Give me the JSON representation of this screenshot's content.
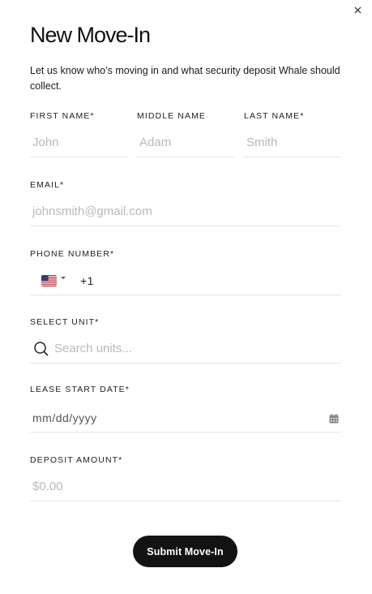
{
  "modal": {
    "title": "New Move-In",
    "subtitle": "Let us know who’s moving in and what security deposit Whale should collect."
  },
  "fields": {
    "first_name": {
      "label": "FIRST NAME*",
      "placeholder": "John"
    },
    "middle_name": {
      "label": "MIDDLE NAME",
      "placeholder": "Adam"
    },
    "last_name": {
      "label": "LAST NAME*",
      "placeholder": "Smith"
    },
    "email": {
      "label": "EMAIL*",
      "placeholder": "johnsmith@gmail.com"
    },
    "phone": {
      "label": "PHONE NUMBER*",
      "country": "US",
      "dial_code": "+1"
    },
    "unit": {
      "label": "SELECT UNIT*",
      "placeholder": "Search units..."
    },
    "lease_start": {
      "label": "LEASE START DATE*",
      "placeholder": "mm/dd/yyyy"
    },
    "deposit": {
      "label": "DEPOSIT AMOUNT*",
      "placeholder": "$0.00"
    }
  },
  "actions": {
    "submit_label": "Submit Move-In"
  },
  "icons": {
    "close": "close-icon",
    "flag": "us-flag-icon",
    "search": "search-icon",
    "calendar": "calendar-icon"
  },
  "colors": {
    "button_bg": "#131313",
    "placeholder": "#b9b9b9",
    "divider": "#e6e6e6"
  }
}
